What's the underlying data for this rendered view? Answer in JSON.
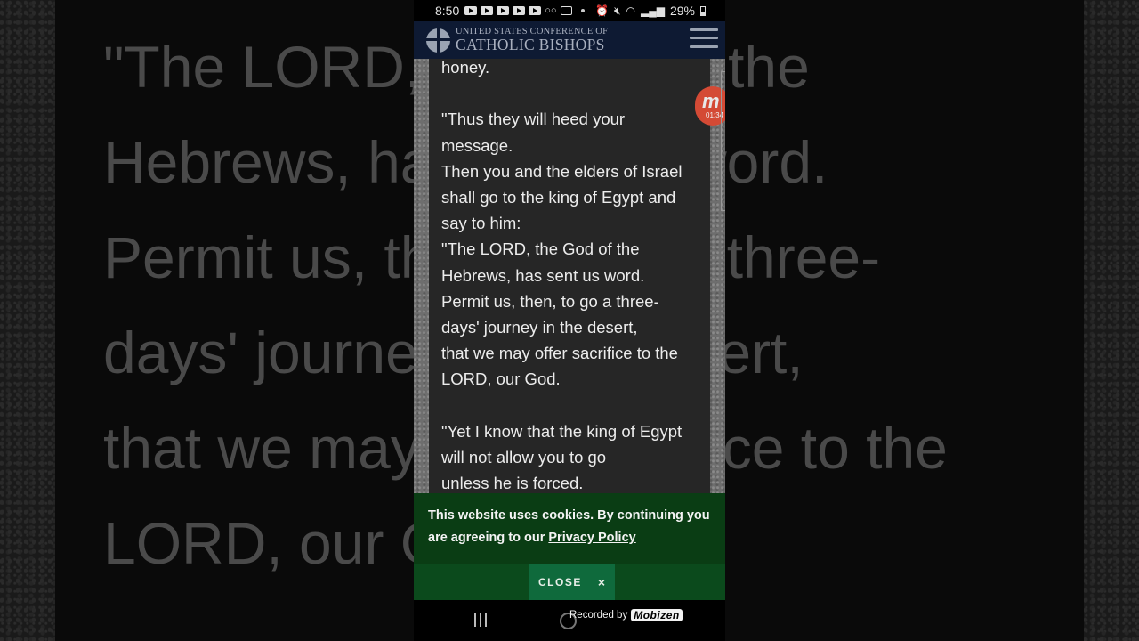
{
  "background": {
    "blurred_lines": [
      "\"The LORD, the God of the",
      "Hebrews, has sent us word.",
      "Permit us, then, to go a three-",
      "days' journey in the desert,",
      "that we may offer sacrifice to the",
      "LORD, our God."
    ]
  },
  "status_bar": {
    "time": "8:50",
    "notification_icons": [
      "youtube-icon",
      "youtube-icon",
      "youtube-icon",
      "youtube-icon",
      "youtube-icon",
      "voicemail-icon",
      "message-icon"
    ],
    "right_icons": [
      "alarm-icon",
      "mute-icon",
      "wifi-icon",
      "signal-icon"
    ],
    "battery": "29%"
  },
  "app_bar": {
    "logo_line1": "UNITED STATES CONFERENCE OF",
    "logo_line2": "CATHOLIC BISHOPS",
    "menu_icon": "hamburger-menu-icon"
  },
  "article": {
    "lines": [
      "honey.",
      "",
      "\"Thus they will heed your",
      "message.",
      "Then you and the elders of Israel",
      "shall go to the king of Egypt and",
      "say to him:",
      "\"The LORD, the God of the",
      "Hebrews, has sent us word.",
      "Permit us, then, to go a three-",
      "days' journey in the desert,",
      "that we may offer sacrifice to the",
      "LORD, our God.",
      "",
      "\"Yet I know that the king of Egypt",
      "will not allow you to go",
      "unless he is forced."
    ]
  },
  "recorder_bubble": {
    "logo": "m",
    "timer": "01:34"
  },
  "cookie_banner": {
    "text": "This website uses cookies. By continuing you are agreeing to our ",
    "link_text": "Privacy Policy",
    "close_label": "CLOSE",
    "close_icon": "×",
    "colors": {
      "banner": "#0a3d14",
      "button": "#0f6a3c"
    }
  },
  "nav_bar": {
    "watermark_prefix": "Recorded by",
    "watermark_brand": "Mobizen"
  }
}
